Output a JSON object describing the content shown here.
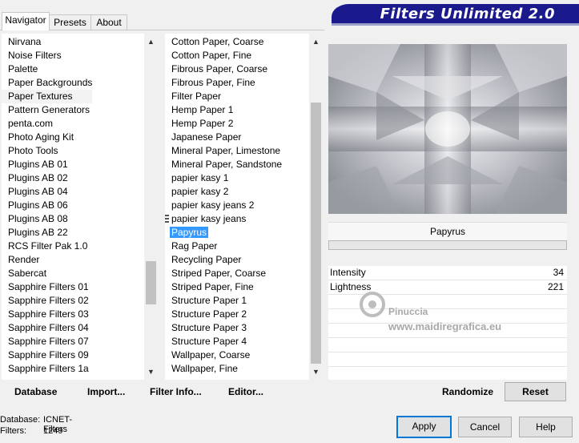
{
  "tabs": [
    "Navigator",
    "Presets",
    "About"
  ],
  "banner": "Filters Unlimited 2.0",
  "categories": [
    "Nirvana",
    "Noise Filters",
    "Palette",
    "Paper Backgrounds",
    "Paper Textures",
    "Pattern Generators",
    "penta.com",
    "Photo Aging Kit",
    "Photo Tools",
    "Plugins AB 01",
    "Plugins AB 02",
    "Plugins AB 04",
    "Plugins AB 06",
    "Plugins AB 08",
    "Plugins AB 22",
    "RCS Filter Pak 1.0",
    "Render",
    "Sabercat",
    "Sapphire Filters 01",
    "Sapphire Filters 02",
    "Sapphire Filters 03",
    "Sapphire Filters 04",
    "Sapphire Filters 07",
    "Sapphire Filters 09",
    "Sapphire Filters 1a"
  ],
  "filters": [
    "Cotton Paper, Coarse",
    "Cotton Paper, Fine",
    "Fibrous Paper, Coarse",
    "Fibrous Paper, Fine",
    "Filter Paper",
    "Hemp Paper 1",
    "Hemp Paper 2",
    "Japanese Paper",
    "Mineral Paper, Limestone",
    "Mineral Paper, Sandstone",
    "papier kasy 1",
    "papier kasy 2",
    "papier kasy jeans 2",
    "papier kasy jeans",
    "Papyrus",
    "Rag Paper",
    "Recycling Paper",
    "Striped Paper, Coarse",
    "Striped Paper, Fine",
    "Structure Paper 1",
    "Structure Paper 2",
    "Structure Paper 3",
    "Structure Paper 4",
    "Wallpaper, Coarse",
    "Wallpaper, Fine"
  ],
  "selected_filter_name": "Papyrus",
  "params": [
    {
      "label": "Intensity",
      "value": "34"
    },
    {
      "label": "Lightness",
      "value": "221"
    }
  ],
  "watermark": {
    "name": "Pinuccia",
    "url": "www.maidiregrafica.eu"
  },
  "buttons": {
    "database": "Database",
    "import": "Import...",
    "filter_info": "Filter Info...",
    "editor": "Editor...",
    "randomize": "Randomize",
    "reset": "Reset",
    "apply": "Apply",
    "cancel": "Cancel",
    "help": "Help"
  },
  "status": {
    "database_label": "Database:",
    "database_value": "ICNET-Filters",
    "filters_label": "Filters:",
    "filters_value": "1249"
  },
  "colors": {
    "selection": "#3399ff",
    "banner": "#1a1a8c"
  }
}
